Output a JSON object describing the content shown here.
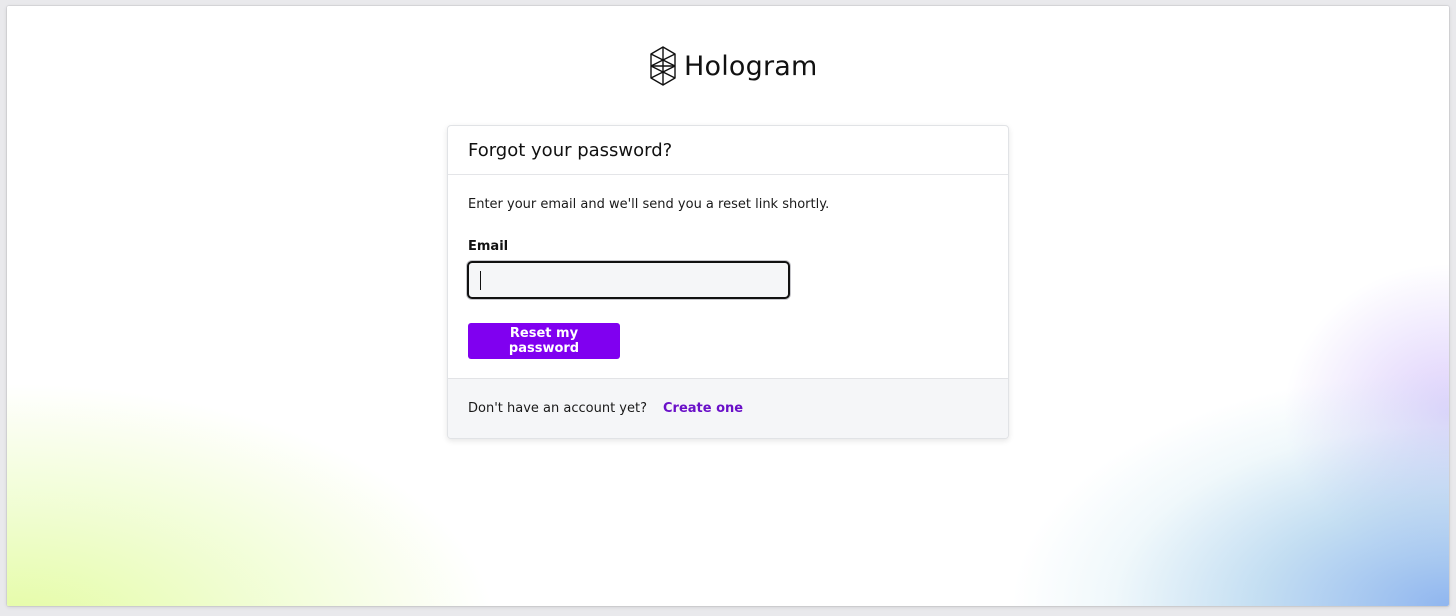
{
  "brand": {
    "name": "Hologram",
    "logo_icon": "hologram-logo-icon",
    "text_color": "#111111"
  },
  "card": {
    "title": "Forgot your password?",
    "intro": "Enter your email and we'll send you a reset link shortly.",
    "email_label": "Email",
    "email_value": "",
    "email_placeholder": "",
    "submit_label": "Reset my password",
    "footer_text": "Don't have an account yet?",
    "create_link": "Create one"
  },
  "colors": {
    "accent": "#8000f0",
    "link": "#6a10c8",
    "footer_bg": "#f5f6f8"
  }
}
